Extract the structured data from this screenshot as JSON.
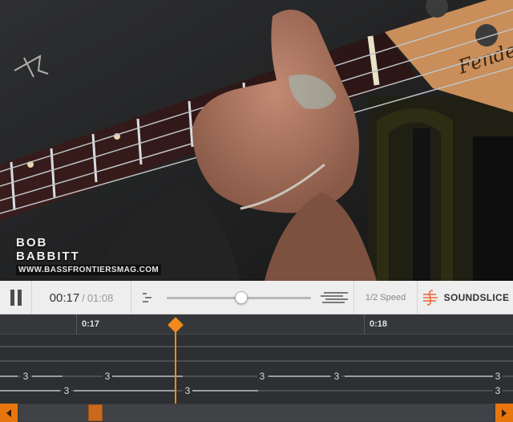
{
  "video": {
    "caption_line1": "BOB",
    "caption_line2": "BABBITT",
    "caption_url": "WWW.BASSFRONTIERSMAG.COM",
    "guitar_logo": "Fender"
  },
  "controls": {
    "pause_icon": "pause-icon",
    "current_time": "00:17",
    "time_separator": "/",
    "duration": "01:08",
    "speed_slider_percent": 52,
    "speed_label": "1/2 Speed",
    "brand_label": "SOUNDSLICE",
    "brand_color": "#f2663a"
  },
  "tab": {
    "markers": [
      {
        "label": "0:17"
      },
      {
        "label": "0:18"
      }
    ],
    "notes": [
      "3",
      "3",
      "3",
      "3",
      "3",
      "3",
      "3",
      "3"
    ],
    "playhead_color": "#f28a1b"
  },
  "scrollbar": {
    "left_icon": "arrow-left-icon",
    "right_icon": "arrow-right-icon",
    "accent": "#e7760f"
  }
}
